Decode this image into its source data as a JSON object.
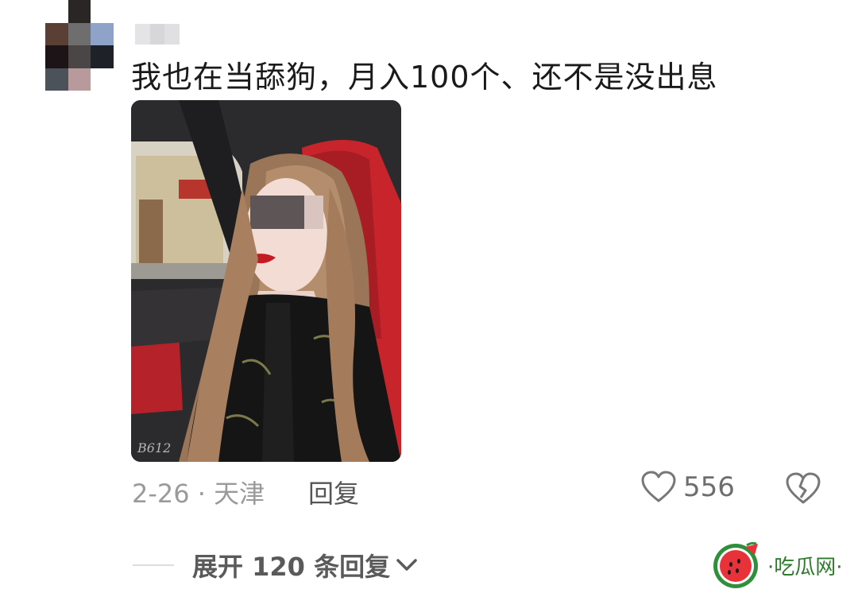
{
  "comment": {
    "text": "我也在当舔狗，月入100个、还不是没出息",
    "photo_watermark": "B612",
    "meta": "2-26 · 天津",
    "reply_label": "回复",
    "like_count": "556",
    "expand_label": "展开 120 条回复"
  },
  "watermark": {
    "site_name": "·吃瓜网·"
  },
  "icons": [
    "heart-icon",
    "broken-heart-icon",
    "chevron-down-icon",
    "watermelon-logo-icon"
  ],
  "colors": {
    "meta_gray": "#9a9a9a",
    "reply_gray": "#555555",
    "site_green": "#2f7a2f",
    "seat_red": "#c8242b"
  }
}
